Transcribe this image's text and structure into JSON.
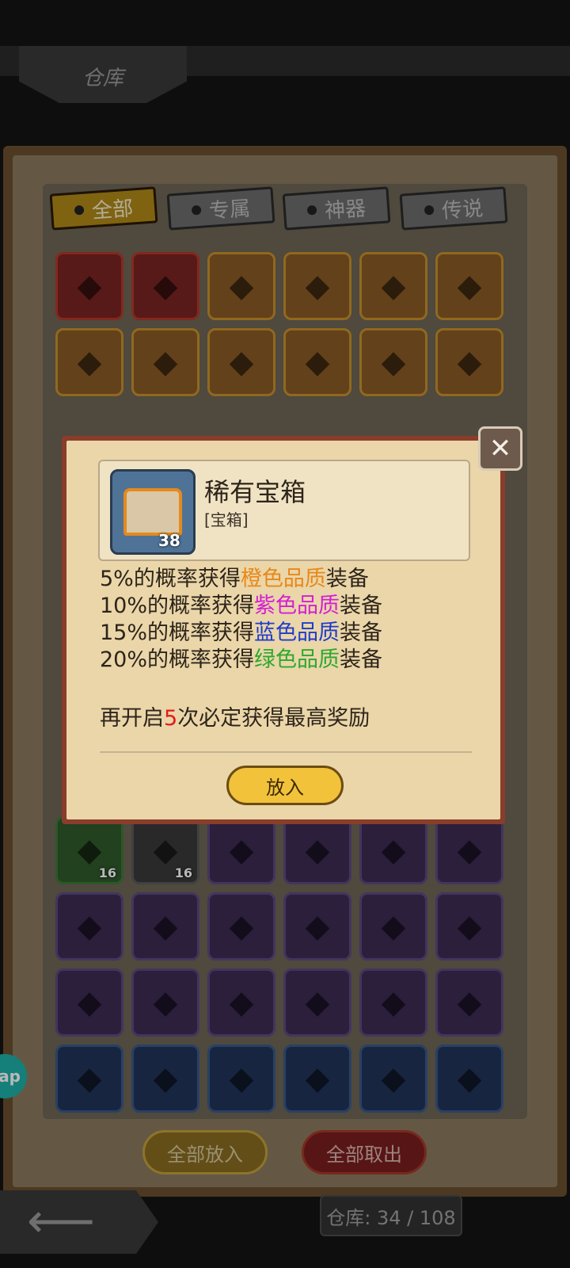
{
  "header": {
    "title": "仓库"
  },
  "tabs": [
    {
      "label": "全部",
      "active": true
    },
    {
      "label": "专属",
      "active": false
    },
    {
      "label": "神器",
      "active": false
    },
    {
      "label": "传说",
      "active": false
    }
  ],
  "grid_top": [
    [
      {
        "icon": "crossed-swords",
        "quality": "red"
      },
      {
        "icon": "chalice",
        "quality": "red"
      },
      {
        "icon": "dark-helmet",
        "quality": "orange"
      },
      {
        "icon": "shield",
        "quality": "orange"
      },
      {
        "icon": "crossbow",
        "quality": "orange"
      },
      {
        "icon": "dark-crossbow",
        "quality": "orange"
      }
    ],
    [
      {
        "icon": "green-potion",
        "quality": "orange"
      },
      {
        "icon": "armor",
        "quality": "orange"
      },
      {
        "icon": "blue-gem-ring",
        "quality": "orange"
      },
      {
        "icon": "blue-gem-ring",
        "quality": "orange"
      },
      {
        "icon": "rifle",
        "quality": "orange"
      },
      {
        "icon": "axe",
        "quality": "orange"
      }
    ]
  ],
  "grid_bottom": [
    [
      {
        "icon": "chest",
        "quality": "green",
        "count": "16"
      },
      {
        "icon": "chest",
        "quality": "gray",
        "count": "16"
      },
      {
        "icon": "dark-armor",
        "quality": "purple"
      },
      {
        "icon": "fang-necklace",
        "quality": "purple"
      },
      {
        "icon": "fang-necklace",
        "quality": "purple"
      },
      {
        "icon": "red-ring",
        "quality": "purple"
      }
    ],
    [
      {
        "icon": "blue-ring",
        "quality": "purple"
      },
      {
        "icon": "feather",
        "quality": "purple"
      },
      {
        "icon": "star-amulet",
        "quality": "purple"
      },
      {
        "icon": "gold-helmet",
        "quality": "purple"
      },
      {
        "icon": "gold-helmet",
        "quality": "purple"
      },
      {
        "icon": "backpack",
        "quality": "purple"
      }
    ],
    [
      {
        "icon": "backpack",
        "quality": "purple"
      },
      {
        "icon": "winged-boots",
        "quality": "purple"
      },
      {
        "icon": "winged-boots",
        "quality": "purple"
      },
      {
        "icon": "green-sword",
        "quality": "purple"
      },
      {
        "icon": "green-sword",
        "quality": "purple"
      },
      {
        "icon": "gem-staff",
        "quality": "purple"
      }
    ],
    [
      {
        "icon": "whip",
        "quality": "blue"
      },
      {
        "icon": "whip",
        "quality": "blue"
      },
      {
        "icon": "red-gloves",
        "quality": "blue"
      },
      {
        "icon": "red-gloves",
        "quality": "blue"
      },
      {
        "icon": "red-gloves",
        "quality": "blue"
      },
      {
        "icon": "staff",
        "quality": "blue"
      }
    ]
  ],
  "popup": {
    "item_name": "稀有宝箱",
    "item_type": "[宝箱]",
    "item_count": "38",
    "lines": [
      {
        "prefix": "5%的概率获得",
        "highlight": "橙色品质",
        "suffix": "装备",
        "color": "#e8881a"
      },
      {
        "prefix": "10%的概率获得",
        "highlight": "紫色品质",
        "suffix": "装备",
        "color": "#d41fd4"
      },
      {
        "prefix": "15%的概率获得",
        "highlight": "蓝色品质",
        "suffix": "装备",
        "color": "#1f3ccc"
      },
      {
        "prefix": "20%的概率获得",
        "highlight": "绿色品质",
        "suffix": "装备",
        "color": "#2ea82e"
      }
    ],
    "bonus": {
      "prefix": "再开启",
      "count": "5",
      "suffix": "次必定获得最高奖励"
    },
    "put_in_label": "放入",
    "close_icon": "close-icon"
  },
  "footer": {
    "put_all_label": "全部放入",
    "take_all_label": "全部取出",
    "storage_text": "仓库: 34 / 108",
    "side_badge": "ap"
  }
}
